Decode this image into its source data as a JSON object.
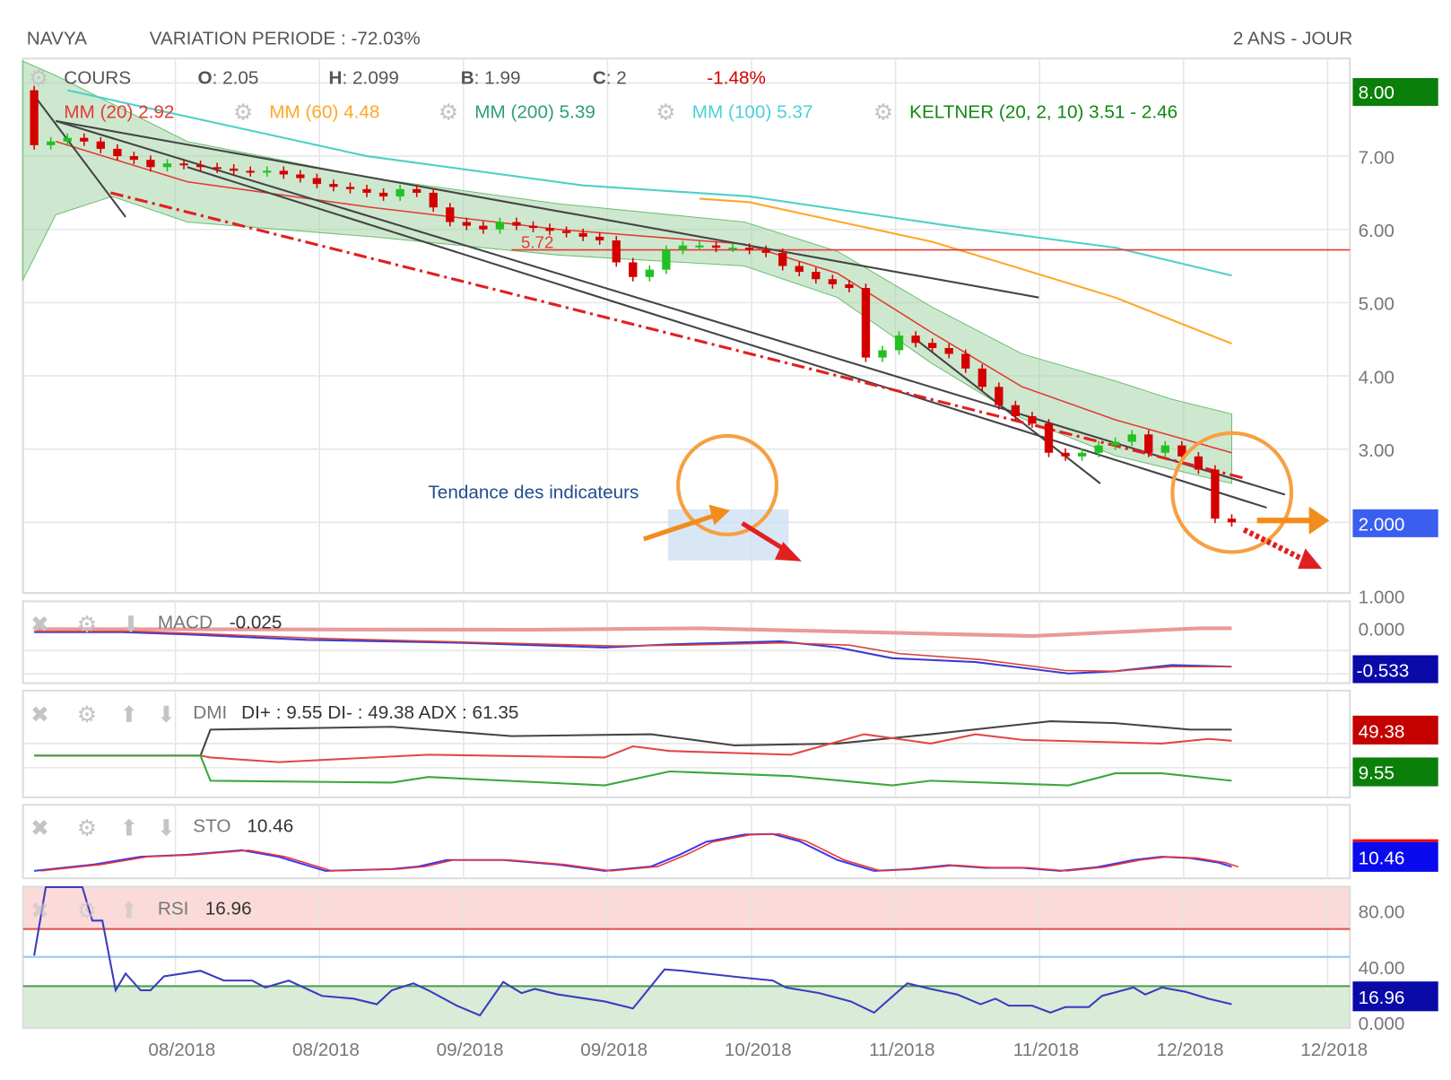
{
  "header": {
    "symbol": "NAVYA",
    "variation": "VARIATION PERIODE : -72.03%",
    "period": "2 ANS - JOUR"
  },
  "legend": {
    "cours": "COURS",
    "open_label": "O",
    "open": ": 2.05",
    "high_label": "H",
    "high": ": 2.099",
    "low_label": "B",
    "low": ": 1.99",
    "close_label": "C",
    "close": ": 2",
    "change": "-1.48%",
    "mm20": "MM (20) 2.92",
    "mm60": "MM (60) 4.48",
    "mm200": "MM (200) 5.39",
    "mm100": "MM (100) 5.37",
    "keltner": "KELTNER (20, 2, 10) 3.51 - 2.46"
  },
  "annotation": {
    "text": "Tendance des indicateurs",
    "level_label": "5.72"
  },
  "colors": {
    "up": "#22c022",
    "down": "#d40000",
    "mm20": "#e53935",
    "mm60": "#ffa726",
    "mm100": "#4dd0c8",
    "keltner_fill": "#a5d6a7"
  },
  "chart_data": {
    "type": "candlestick",
    "title": "NAVYA",
    "x_tick_labels": [
      "08/2018",
      "08/2018",
      "09/2018",
      "09/2018",
      "10/2018",
      "11/2018",
      "11/2018",
      "12/2018",
      "12/2018"
    ],
    "y_tick_labels": [
      "8.00",
      "7.00",
      "6.00",
      "5.00",
      "4.00",
      "3.00",
      "2.000",
      "1.000"
    ],
    "ylim": [
      1,
      8
    ],
    "last_price_badge": "2.000",
    "top_badge": "8.00",
    "first_open": 7.9,
    "closes": [
      7.15,
      7.2,
      7.25,
      7.2,
      7.1,
      7.0,
      6.95,
      6.85,
      6.9,
      6.88,
      6.85,
      6.83,
      6.8,
      6.78,
      6.8,
      6.75,
      6.7,
      6.62,
      6.58,
      6.55,
      6.5,
      6.45,
      6.55,
      6.5,
      6.3,
      6.1,
      6.05,
      6.0,
      6.1,
      6.05,
      6.02,
      5.98,
      5.95,
      5.9,
      5.85,
      5.55,
      5.35,
      5.45,
      5.72,
      5.78,
      5.78,
      5.75,
      5.75,
      5.72,
      5.68,
      5.5,
      5.42,
      5.32,
      5.25,
      5.2,
      4.25,
      4.35,
      4.55,
      4.45,
      4.38,
      4.3,
      4.1,
      3.85,
      3.6,
      3.45,
      3.35,
      2.95,
      2.9,
      2.95,
      3.05,
      3.1,
      3.2,
      2.95,
      3.05,
      2.9,
      2.72,
      2.05,
      2.0
    ],
    "overlays": {
      "keltner_upper": [
        [
          -0.7,
          8.3
        ],
        [
          1.3,
          8.1
        ],
        [
          9.2,
          7.2
        ],
        [
          20.3,
          6.7
        ],
        [
          31.5,
          6.35
        ],
        [
          42.7,
          6.1
        ],
        [
          48.3,
          5.7
        ],
        [
          53.9,
          4.95
        ],
        [
          59.4,
          4.3
        ],
        [
          65,
          3.93
        ],
        [
          68.4,
          3.68
        ],
        [
          72,
          3.48
        ]
      ],
      "keltner_lower": [
        [
          -0.7,
          5.3
        ],
        [
          1.3,
          6.2
        ],
        [
          4.7,
          6.45
        ],
        [
          9.2,
          6.1
        ],
        [
          20.3,
          5.9
        ],
        [
          31.5,
          5.65
        ],
        [
          42.7,
          5.5
        ],
        [
          48.3,
          5.07
        ],
        [
          53.9,
          4.18
        ],
        [
          59.4,
          3.42
        ],
        [
          65,
          2.91
        ],
        [
          72,
          2.53
        ]
      ],
      "mm20": [
        [
          1.3,
          7.2
        ],
        [
          9.2,
          6.65
        ],
        [
          20.3,
          6.3
        ],
        [
          31.5,
          6.0
        ],
        [
          42.7,
          5.8
        ],
        [
          48.3,
          5.4
        ],
        [
          53.9,
          4.6
        ],
        [
          59.4,
          3.85
        ],
        [
          65,
          3.4
        ],
        [
          72,
          2.95
        ]
      ],
      "mm60": [
        [
          40,
          6.42
        ],
        [
          43,
          6.37
        ],
        [
          54,
          5.83
        ],
        [
          65,
          5.07
        ],
        [
          72,
          4.44
        ]
      ],
      "mm100": [
        [
          2,
          7.9
        ],
        [
          10,
          7.5
        ],
        [
          20,
          7.0
        ],
        [
          33,
          6.6
        ],
        [
          43,
          6.45
        ],
        [
          55,
          6.05
        ],
        [
          65,
          5.75
        ],
        [
          72,
          5.37
        ]
      ],
      "level": 5.72,
      "trendlines": [
        [
          [
            -0.2,
            7.89
          ],
          [
            5.5,
            6.17
          ]
        ],
        [
          [
            1.3,
            7.48
          ],
          [
            75.2,
            2.38
          ]
        ],
        [
          [
            1.3,
            7.48
          ],
          [
            60.4,
            5.07
          ]
        ],
        [
          [
            9.2,
            6.85
          ],
          [
            74.1,
            2.2
          ]
        ],
        [
          [
            53,
            4.5
          ],
          [
            64.1,
            2.53
          ]
        ]
      ],
      "support_dashed": [
        [
          4.6,
          6.5
        ],
        [
          72.8,
          2.6
        ]
      ]
    },
    "indicators": {
      "macd": {
        "label": "MACD",
        "value": "-0.025",
        "axis": "0.000",
        "badge": "-0.533",
        "macd": [
          [
            0,
            -0.05
          ],
          [
            5.3,
            -0.05
          ],
          [
            9.2,
            -0.08
          ],
          [
            16.4,
            -0.15
          ],
          [
            25.9,
            -0.19
          ],
          [
            34.3,
            -0.25
          ],
          [
            38.2,
            -0.21
          ],
          [
            44.9,
            -0.17
          ],
          [
            48.3,
            -0.25
          ],
          [
            51.6,
            -0.39
          ],
          [
            56.6,
            -0.44
          ],
          [
            62.2,
            -0.59
          ],
          [
            65,
            -0.56
          ],
          [
            68.4,
            -0.48
          ],
          [
            72,
            -0.5
          ]
        ],
        "signal": [
          [
            0,
            -0.04
          ],
          [
            6,
            -0.04
          ],
          [
            10,
            -0.07
          ],
          [
            17,
            -0.13
          ],
          [
            26,
            -0.18
          ],
          [
            35,
            -0.23
          ],
          [
            39,
            -0.22
          ],
          [
            45,
            -0.19
          ],
          [
            49,
            -0.22
          ],
          [
            52,
            -0.33
          ],
          [
            57,
            -0.41
          ],
          [
            62,
            -0.55
          ],
          [
            65,
            -0.56
          ],
          [
            68.4,
            -0.5
          ],
          [
            72,
            -0.5
          ]
        ],
        "histogram": [
          [
            0,
            -0.01
          ],
          [
            30,
            -0.02
          ],
          [
            40,
            0.0
          ],
          [
            52,
            -0.06
          ],
          [
            60,
            -0.1
          ],
          [
            65,
            -0.05
          ],
          [
            70,
            0
          ],
          [
            72,
            0
          ]
        ]
      },
      "dmi": {
        "label": "DMI",
        "value": "DI+ : 9.55 DI- : 49.38 ADX : 61.35",
        "badge_minus": "49.38",
        "badge_plus": "9.55",
        "adx": [
          [
            0,
            32
          ],
          [
            10,
            32
          ],
          [
            10.6,
            60
          ],
          [
            21.5,
            63
          ],
          [
            28.7,
            53
          ],
          [
            37.1,
            55
          ],
          [
            42.1,
            43
          ],
          [
            48.3,
            45
          ],
          [
            53.9,
            55
          ],
          [
            61.1,
            69
          ],
          [
            65,
            67
          ],
          [
            69.5,
            60
          ],
          [
            72,
            60
          ]
        ],
        "di_minus": [
          [
            0,
            32
          ],
          [
            10,
            32
          ],
          [
            10.6,
            30
          ],
          [
            14.7,
            25
          ],
          [
            23.7,
            33
          ],
          [
            34.3,
            30
          ],
          [
            36,
            42
          ],
          [
            38.2,
            37
          ],
          [
            45.5,
            33
          ],
          [
            49.9,
            55
          ],
          [
            53.9,
            45
          ],
          [
            56.6,
            55
          ],
          [
            59.4,
            49
          ],
          [
            67.8,
            45
          ],
          [
            70.6,
            50
          ],
          [
            72,
            48
          ]
        ],
        "di_plus": [
          [
            0,
            32
          ],
          [
            10,
            32
          ],
          [
            10.6,
            5
          ],
          [
            21.5,
            3
          ],
          [
            23.7,
            9
          ],
          [
            34.3,
            0
          ],
          [
            38.2,
            15
          ],
          [
            45.5,
            10
          ],
          [
            51.6,
            0
          ],
          [
            53.9,
            5
          ],
          [
            62.2,
            0
          ],
          [
            65,
            13
          ],
          [
            67.8,
            13
          ],
          [
            72,
            5
          ]
        ]
      },
      "sto": {
        "label": "STO",
        "value": "10.46",
        "badge": "10.46",
        "k": [
          [
            0,
            4.3
          ],
          [
            3.6,
            14
          ],
          [
            6.4,
            26
          ],
          [
            9.2,
            29
          ],
          [
            12.5,
            36
          ],
          [
            14.7,
            26
          ],
          [
            17.5,
            4.3
          ],
          [
            21.5,
            7
          ],
          [
            23.1,
            11
          ],
          [
            24.8,
            21
          ],
          [
            28.2,
            21
          ],
          [
            31.5,
            14
          ],
          [
            34.3,
            4.3
          ],
          [
            37.1,
            11
          ],
          [
            38.8,
            29
          ],
          [
            40.4,
            49
          ],
          [
            42.7,
            60
          ],
          [
            44.4,
            61
          ],
          [
            46,
            50
          ],
          [
            48.3,
            21
          ],
          [
            50.5,
            4.3
          ],
          [
            52.7,
            7
          ],
          [
            55,
            13
          ],
          [
            57.2,
            9
          ],
          [
            59.4,
            9
          ],
          [
            61.7,
            4.3
          ],
          [
            63.9,
            10
          ],
          [
            66.1,
            21
          ],
          [
            67.8,
            26
          ],
          [
            69.5,
            24
          ],
          [
            71.2,
            17
          ],
          [
            72,
            10.5
          ]
        ]
      },
      "rsi": {
        "label": "RSI",
        "value": "16.96",
        "badge": "16.96",
        "axis": [
          "80.00",
          "40.00",
          "0.000"
        ],
        "overbought": 67,
        "mid": 47,
        "oversold": 26,
        "values": [
          [
            0,
            48
          ],
          [
            0.7,
            97
          ],
          [
            2.9,
            97
          ],
          [
            3.5,
            73
          ],
          [
            4.1,
            73
          ],
          [
            4.9,
            23
          ],
          [
            5.5,
            35
          ],
          [
            6.4,
            23
          ],
          [
            7,
            23
          ],
          [
            7.8,
            33
          ],
          [
            10,
            37
          ],
          [
            11.4,
            30
          ],
          [
            13.1,
            30
          ],
          [
            13.9,
            25
          ],
          [
            15.3,
            30
          ],
          [
            17.3,
            19
          ],
          [
            19.2,
            17
          ],
          [
            20.6,
            13
          ],
          [
            21.5,
            23
          ],
          [
            22.8,
            28
          ],
          [
            23.7,
            23
          ],
          [
            25.4,
            12
          ],
          [
            26.8,
            5
          ],
          [
            28.2,
            29
          ],
          [
            29.3,
            21
          ],
          [
            30.1,
            24
          ],
          [
            31.5,
            20
          ],
          [
            34.3,
            15
          ],
          [
            36,
            10
          ],
          [
            37.9,
            38
          ],
          [
            39,
            37
          ],
          [
            40.4,
            35
          ],
          [
            42.7,
            32
          ],
          [
            44.4,
            30
          ],
          [
            45.2,
            25
          ],
          [
            47.2,
            21
          ],
          [
            49.1,
            15
          ],
          [
            50.5,
            7
          ],
          [
            52.5,
            28
          ],
          [
            53.9,
            24
          ],
          [
            55.5,
            20
          ],
          [
            56.9,
            13
          ],
          [
            57.8,
            17
          ],
          [
            58.6,
            12
          ],
          [
            60,
            12
          ],
          [
            61.1,
            7
          ],
          [
            62,
            11
          ],
          [
            63.4,
            11
          ],
          [
            64.2,
            19
          ],
          [
            66.1,
            25
          ],
          [
            66.8,
            20
          ],
          [
            67.8,
            25
          ],
          [
            69.2,
            22
          ],
          [
            70.6,
            17
          ],
          [
            72,
            13
          ]
        ]
      }
    }
  }
}
